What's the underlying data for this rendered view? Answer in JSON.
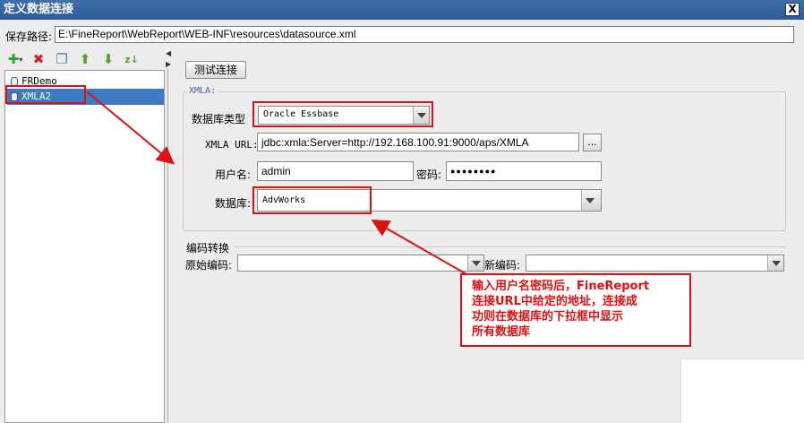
{
  "window": {
    "title": "定义数据连接",
    "close_label": "X"
  },
  "save_path": {
    "label": "保存路径:",
    "value": "E:\\FineReport\\WebReport\\WEB-INF\\resources\\datasource.xml"
  },
  "toolbar": {
    "icons": [
      "add-icon",
      "delete-icon",
      "copy-icon",
      "move-up-icon",
      "move-down-icon",
      "sort-icon"
    ]
  },
  "connections": [
    {
      "name": "FRDemo",
      "selected": false
    },
    {
      "name": "XMLA2",
      "selected": true
    }
  ],
  "test_button": "测试连接",
  "xmla": {
    "group_title": "XMLA:",
    "db_type_label": "数据库类型",
    "db_type_value": "Oracle Essbase",
    "url_label": "XMLA URL:",
    "url_value": "jdbc:xmla:Server=http://192.168.100.91:9000/aps/XMLA",
    "browse_label": "...",
    "username_label": "用户名:",
    "username_value": "admin",
    "password_label": "密码:",
    "password_value": "●●●●●●●●",
    "database_label": "数据库:",
    "database_value": "AdvWorks"
  },
  "encoding": {
    "group_title": "编码转换",
    "original_label": "原始编码:",
    "original_value": "",
    "new_label": "新编码:",
    "new_value": ""
  },
  "annotation": {
    "text": "输入用户名密码后，FineReport\n连接URL中给定的地址，连接成\n功则在数据库的下拉框中显示\n所有数据库",
    "color": "#e01010"
  }
}
